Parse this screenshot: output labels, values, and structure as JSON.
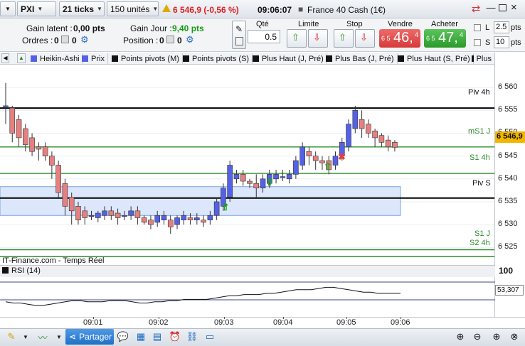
{
  "toolbar": {
    "instrument": "PXI",
    "interval": "21 ticks",
    "units": "150 unités",
    "price_change": "6 546,9 (-0,56 %)",
    "time": "09:06:07",
    "instrument_name": "France 40 Cash (1€)"
  },
  "panel": {
    "gain_latent_label": "Gain latent :",
    "gain_latent_value": "0,00 pts",
    "gain_jour_label": "Gain Jour :",
    "gain_jour_value": "9,40 pts",
    "ordres_label": "Ordres :",
    "ordres_value": "0",
    "ordres_count": "0",
    "position_label": "Position :",
    "position_value": "0",
    "position_count": "0"
  },
  "order": {
    "qty_label": "Qté",
    "qty_value": "0.5",
    "limit_label": "Limite",
    "stop_label": "Stop",
    "sell_label": "Vendre",
    "sell_prefix": "6 5",
    "sell_big": "46,",
    "sell_sup": "4",
    "buy_label": "Acheter",
    "buy_prefix": "6 5",
    "buy_big": "47,",
    "buy_sup": "4",
    "l_label": "L",
    "l_value": "2.5",
    "l_unit": "pts",
    "s_label": "S",
    "s_value": "10",
    "s_unit": "pts"
  },
  "tabs": [
    "Heikin-Ashi",
    "Prix",
    "Points pivots (M)",
    "Points pivots (S)",
    "Plus Haut (J, Pré)",
    "Plus Bas (J, Pré)",
    "Plus Haut (S, Pré)",
    "Plus"
  ],
  "yticks": [
    "6 560",
    "6 555",
    "6 550",
    "6 545",
    "6 540",
    "6 535",
    "6 530",
    "6 525"
  ],
  "levels": {
    "piv4h": "Piv 4h",
    "ms1j": "mS1 J",
    "s14h": "S1 4h",
    "pivs": "Piv S",
    "s1j": "S1 J",
    "s24h": "S2 4h"
  },
  "current_price": "6 546,9",
  "source_label": "IT-Finance.com - Temps Réel",
  "rsi": {
    "label": "RSI (14)",
    "level_100": "100",
    "value": "53,307"
  },
  "xticks": [
    "09:01",
    "09:02",
    "09:03",
    "09:04",
    "09:05",
    "09:06"
  ],
  "bottom": {
    "share_label": "Partager"
  },
  "colors": {
    "up": "#5461e6",
    "down": "#e58080",
    "sell": "#e04848",
    "buy": "#2faa2f",
    "pivot": "#000000",
    "support": "#2e8b2e"
  },
  "chart_data": {
    "type": "candlestick",
    "style": "Heikin-Ashi",
    "ylim": [
      6521,
      6565
    ],
    "candles": [
      [
        6556,
        6556,
        6561,
        6552
      ],
      [
        6555.5,
        6550,
        6556,
        6548
      ],
      [
        6553,
        6549,
        6554,
        6547
      ],
      [
        6551,
        6547.5,
        6552,
        6546
      ],
      [
        6549,
        6546,
        6550,
        6545
      ],
      [
        6547,
        6546.5,
        6548,
        6544
      ],
      [
        6547,
        6545,
        6548,
        6544
      ],
      [
        6545,
        6543,
        6546,
        6540
      ],
      [
        6543,
        6537,
        6544,
        6536
      ],
      [
        6539,
        6534,
        6540,
        6532
      ],
      [
        6536,
        6533,
        6537,
        6530
      ],
      [
        6534,
        6531,
        6535,
        6530
      ],
      [
        6533,
        6531.5,
        6534,
        6530
      ],
      [
        6532,
        6532,
        6533,
        6531
      ],
      [
        6531.5,
        6532.5,
        6533,
        6530.5
      ],
      [
        6532,
        6533,
        6534,
        6531
      ],
      [
        6533,
        6532,
        6534,
        6531
      ],
      [
        6532.5,
        6531.5,
        6533.5,
        6530
      ],
      [
        6532,
        6532,
        6533,
        6531
      ],
      [
        6532,
        6533,
        6534,
        6531
      ],
      [
        6533,
        6531.5,
        6534,
        6530
      ],
      [
        6531.5,
        6530.5,
        6532,
        6530
      ],
      [
        6531,
        6530,
        6532,
        6529
      ],
      [
        6530.5,
        6532,
        6533,
        6529.5
      ],
      [
        6531,
        6532,
        6533,
        6530
      ],
      [
        6531,
        6529.5,
        6532,
        6528
      ],
      [
        6530,
        6531.5,
        6532,
        6529
      ],
      [
        6531,
        6532,
        6533,
        6530
      ],
      [
        6531.5,
        6531,
        6532.5,
        6530
      ],
      [
        6531,
        6531.5,
        6532.5,
        6530
      ],
      [
        6531,
        6530.5,
        6532,
        6529.5
      ],
      [
        6531,
        6532,
        6533,
        6530
      ],
      [
        6532,
        6535,
        6536,
        6531
      ],
      [
        6534,
        6538,
        6539,
        6533
      ],
      [
        6536,
        6543,
        6544,
        6535
      ],
      [
        6540,
        6541,
        6542,
        6539
      ],
      [
        6541,
        6539.5,
        6542,
        6538.5
      ],
      [
        6539.5,
        6539,
        6540,
        6538
      ],
      [
        6539,
        6538,
        6541,
        6536
      ],
      [
        6538,
        6540,
        6541,
        6537
      ],
      [
        6539,
        6541,
        6542,
        6538
      ],
      [
        6540,
        6541,
        6542,
        6539
      ],
      [
        6540.5,
        6540.5,
        6542,
        6539.5
      ],
      [
        6540,
        6541,
        6542,
        6539
      ],
      [
        6541,
        6544,
        6545,
        6540
      ],
      [
        6543,
        6547,
        6548,
        6542
      ],
      [
        6546,
        6545,
        6547,
        6543
      ],
      [
        6545,
        6544,
        6546,
        6542
      ],
      [
        6544,
        6543.5,
        6545,
        6542
      ],
      [
        6544,
        6542,
        6545,
        6541
      ],
      [
        6543,
        6545,
        6546,
        6542
      ],
      [
        6545,
        6548,
        6549,
        6544
      ],
      [
        6547,
        6552,
        6553,
        6546
      ],
      [
        6551,
        6555,
        6556,
        6550
      ],
      [
        6553,
        6551,
        6555,
        6549
      ],
      [
        6552,
        6550,
        6553,
        6549
      ],
      [
        6550.5,
        6549,
        6551,
        6547
      ],
      [
        6549.5,
        6548,
        6550,
        6547
      ],
      [
        6548.5,
        6547,
        6549.5,
        6546
      ],
      [
        6548,
        6546.9,
        6548.5,
        6546
      ]
    ],
    "levels": [
      {
        "name": "Piv 4h",
        "value": 6555.5
      },
      {
        "name": "mS1 J",
        "value": 6547
      },
      {
        "name": "S1 4h",
        "value": 6541.2
      },
      {
        "name": "Piv S",
        "value": 6535.8
      },
      {
        "name": "S1 J",
        "value": 6524.5
      },
      {
        "name": "S2 4h",
        "value": 6523
      }
    ],
    "rsi_values": [
      46,
      45,
      45,
      44,
      43,
      43,
      44,
      45,
      46,
      47,
      47,
      46,
      46,
      46,
      47,
      47,
      47,
      46,
      45,
      45,
      46,
      46,
      47,
      47,
      48,
      48,
      48,
      48,
      49,
      50,
      51,
      51,
      52,
      52,
      52,
      53,
      53,
      54,
      55,
      56,
      56,
      56,
      57,
      58,
      58,
      57,
      56,
      55,
      54,
      54,
      53,
      53,
      53,
      53
    ]
  }
}
